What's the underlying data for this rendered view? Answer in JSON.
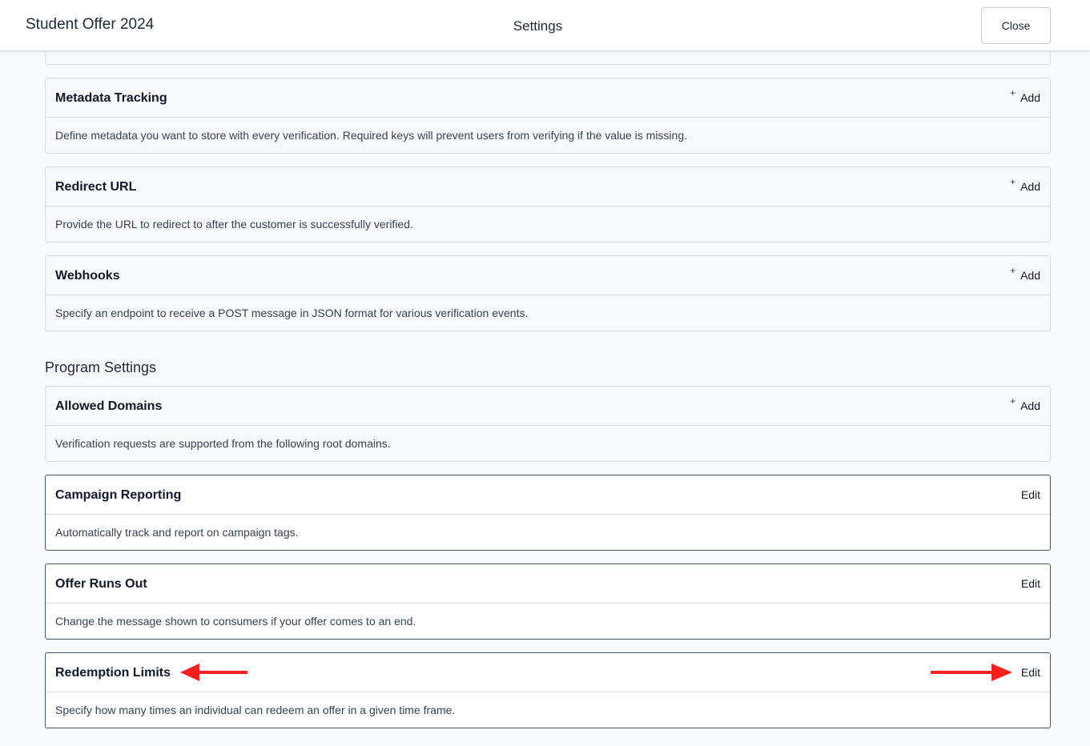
{
  "header": {
    "app_title": "Student Offer 2024",
    "center_title": "Settings",
    "close_label": "Close"
  },
  "integration_cards": [
    {
      "title": "Metadata Tracking",
      "action": "Add",
      "description": "Define metadata you want to store with every verification. Required keys will prevent users from verifying if the value is missing."
    },
    {
      "title": "Redirect URL",
      "action": "Add",
      "description": "Provide the URL to redirect to after the customer is successfully verified."
    },
    {
      "title": "Webhooks",
      "action": "Add",
      "description": "Specify an endpoint to receive a POST message in JSON format for various verification events."
    }
  ],
  "program_settings": {
    "title": "Program Settings",
    "cards": [
      {
        "title": "Allowed Domains",
        "action": "Add",
        "description": "Verification requests are supported from the following root domains."
      },
      {
        "title": "Campaign Reporting",
        "action": "Edit",
        "description": "Automatically track and report on campaign tags."
      },
      {
        "title": "Offer Runs Out",
        "action": "Edit",
        "description": "Change the message shown to consumers if your offer comes to an end."
      },
      {
        "title": "Redemption Limits",
        "action": "Edit",
        "description": "Specify how many times an individual can redeem an offer in a given time frame."
      }
    ]
  },
  "icons": {
    "plus": "plus-icon",
    "arrow": "arrow-icon"
  },
  "colors": {
    "annotation_arrow": "#ff1e1e",
    "card_border_active": "#4b5563"
  }
}
